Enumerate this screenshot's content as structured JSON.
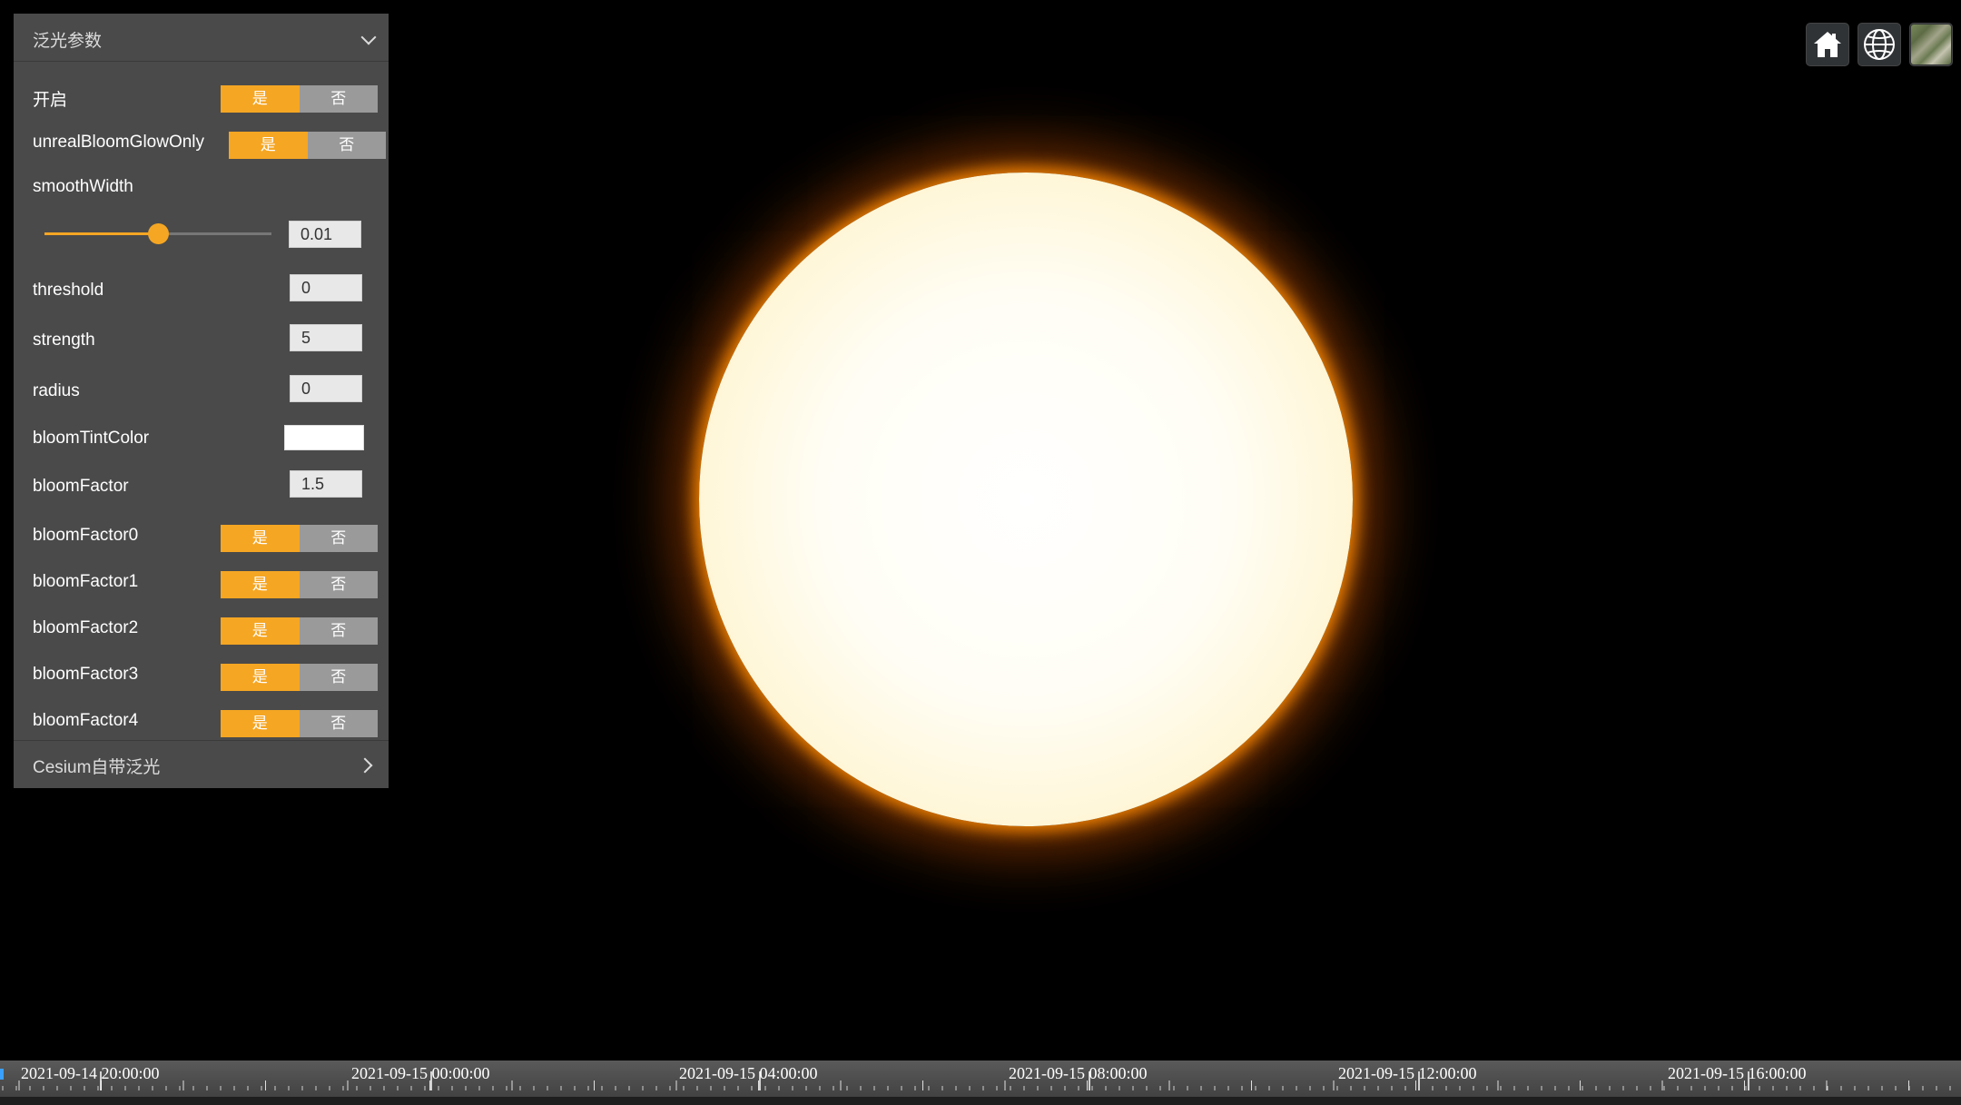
{
  "panel": {
    "header_title": "泛光参数",
    "footer_title": "Cesium自带泛光",
    "yes_label": "是",
    "no_label": "否",
    "enable": {
      "label": "开启"
    },
    "glow_only": {
      "label": "unrealBloomGlowOnly"
    },
    "smooth_width": {
      "label": "smoothWidth",
      "value": "0.01",
      "slider_fraction": 0.5
    },
    "threshold": {
      "label": "threshold",
      "value": "0"
    },
    "strength": {
      "label": "strength",
      "value": "5"
    },
    "radius": {
      "label": "radius",
      "value": "0"
    },
    "tint_color": {
      "label": "bloomTintColor",
      "value": "#ffffff"
    },
    "bloom_factor": {
      "label": "bloomFactor",
      "value": "1.5"
    },
    "factor0": {
      "label": "bloomFactor0"
    },
    "factor1": {
      "label": "bloomFactor1"
    },
    "factor2": {
      "label": "bloomFactor2"
    },
    "factor3": {
      "label": "bloomFactor3"
    },
    "factor4": {
      "label": "bloomFactor4"
    }
  },
  "toolbar": {
    "home_icon": "home-icon",
    "globe_icon": "globe-icon",
    "layer_icon": "layer-picker-icon"
  },
  "timeline": {
    "labels": [
      "2021-09-14 20:00:00",
      "2021-09-15 00:00:00",
      "2021-09-15 04:00:00",
      "2021-09-15 08:00:00",
      "2021-09-15 12:00:00",
      "2021-09-15 16:00:00"
    ]
  },
  "colors": {
    "accent": "#f5a623",
    "panel_bg": "#4a4a4a",
    "toggle_off": "#9a9a9a"
  }
}
